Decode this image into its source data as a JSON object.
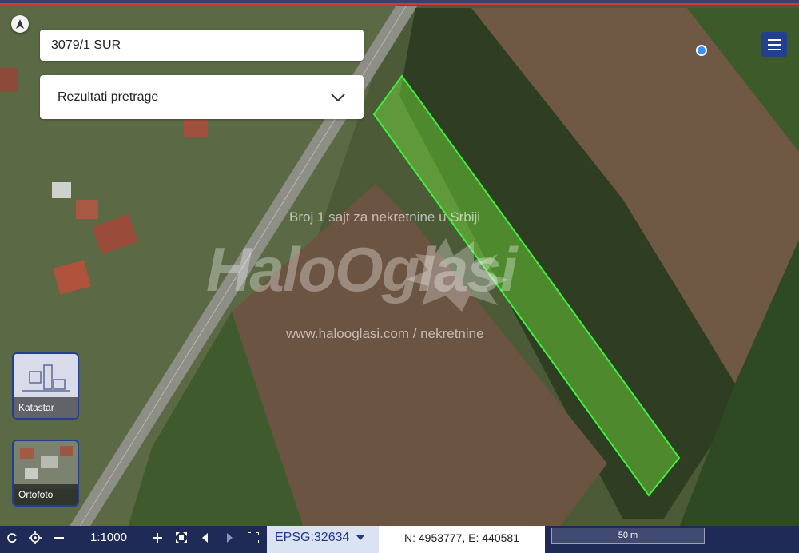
{
  "search": {
    "value": "3079/1 SUR"
  },
  "results_dropdown": {
    "label": "Rezultati pretrage",
    "icon": "chevron-down-icon"
  },
  "watermark": {
    "tagline": "Broj 1 sajt za nekretnine u Srbiji",
    "logo_text": "HaloOglasi",
    "url": "www.halooglasi.com / nekretnine"
  },
  "layers": [
    {
      "label": "Katastar"
    },
    {
      "label": "Ortofoto"
    }
  ],
  "toolbar": {
    "scale": "1:1000",
    "projection": "EPSG:32634",
    "coordinates": "N: 4953777, E: 440581",
    "scale_bar": "50 m"
  },
  "colors": {
    "parcel_outline": "#3cf23c",
    "toolbar_bg": "#1f2a57",
    "accent": "#23408e"
  }
}
